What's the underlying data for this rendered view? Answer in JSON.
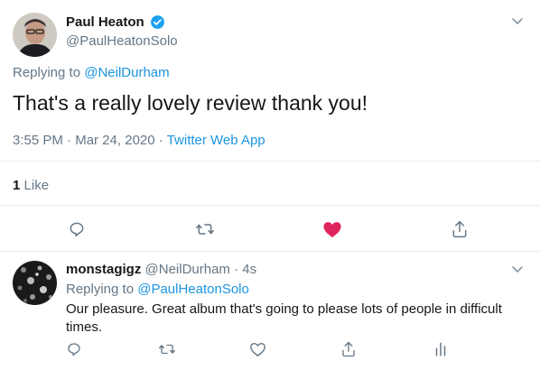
{
  "main_tweet": {
    "author_name": "Paul Heaton",
    "handle": "@PaulHeatonSolo",
    "replying_prefix": "Replying to",
    "replying_to": "@NeilDurham",
    "text": "That's a really lovely review thank you!",
    "time": "3:55 PM",
    "date": "Mar 24, 2020",
    "source": "Twitter Web App",
    "likes_count": "1",
    "likes_label": "Like",
    "liked": true
  },
  "reply": {
    "author_name": "monstagigz",
    "handle": "@NeilDurham",
    "age": "4s",
    "replying_prefix": "Replying to",
    "replying_to": "@PaulHeatonSolo",
    "text": "Our pleasure. Great album that's going to please lots of people in difficult times."
  },
  "colors": {
    "accent": "#1b95e0",
    "like": "#e0245e",
    "muted": "#657786",
    "divider": "#e6ecf0"
  },
  "icons": {
    "main": [
      "verified-badge-icon",
      "chevron-down-icon",
      "reply-icon",
      "retweet-icon",
      "heart-filled-icon",
      "share-icon"
    ],
    "reply": [
      "chevron-down-icon",
      "reply-icon",
      "retweet-icon",
      "heart-icon",
      "share-icon",
      "analytics-icon"
    ]
  }
}
